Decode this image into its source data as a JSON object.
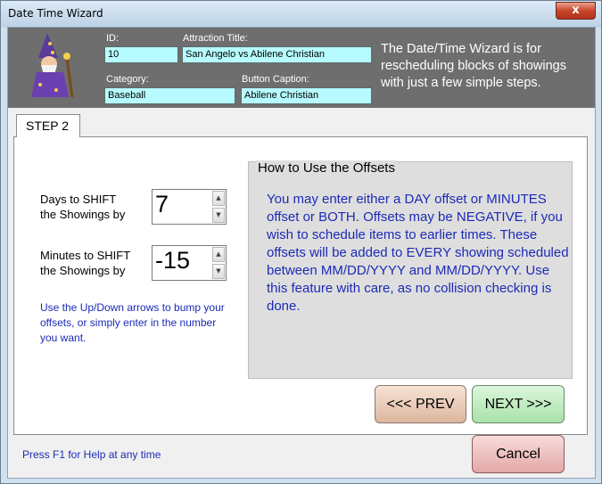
{
  "window": {
    "title": "Date Time Wizard",
    "close_glyph": "x"
  },
  "header": {
    "id": {
      "label": "ID:",
      "value": "10"
    },
    "attraction_title": {
      "label": "Attraction Title:",
      "value": "San Angelo vs Abilene Christian"
    },
    "category": {
      "label": "Category:",
      "value": "Baseball"
    },
    "button_caption": {
      "label": "Button Caption:",
      "value": "Abilene Christian"
    },
    "blurb": "The Date/Time Wizard is for rescheduling blocks of showings with just a few simple steps."
  },
  "tab": {
    "label": "STEP 2"
  },
  "days": {
    "label_line1": "Days to SHIFT",
    "label_line2": "the Showings by",
    "value": "7"
  },
  "minutes": {
    "label_line1": "Minutes to SHIFT",
    "label_line2": "the Showings by",
    "value": "-15"
  },
  "help_text": "Use the Up/Down arrows to bump your offsets, or simply enter in the number you want.",
  "how_to": {
    "title": "How to Use the Offsets",
    "text": "You may enter either a DAY offset or MINUTES offset or BOTH.  Offsets may be NEGATIVE, if you wish to schedule items to earlier times.  These offsets will be added to EVERY showing scheduled between MM/DD/YYYY and MM/DD/YYYY.  Use this feature with care, as no collision checking is done."
  },
  "buttons": {
    "prev": "<<< PREV",
    "next": "NEXT >>>",
    "cancel": "Cancel"
  },
  "footer": {
    "help_hint": "Press F1 for Help at any time"
  },
  "icons": [
    "wizard-icon",
    "spin-up-icon",
    "spin-down-icon",
    "close-icon"
  ]
}
